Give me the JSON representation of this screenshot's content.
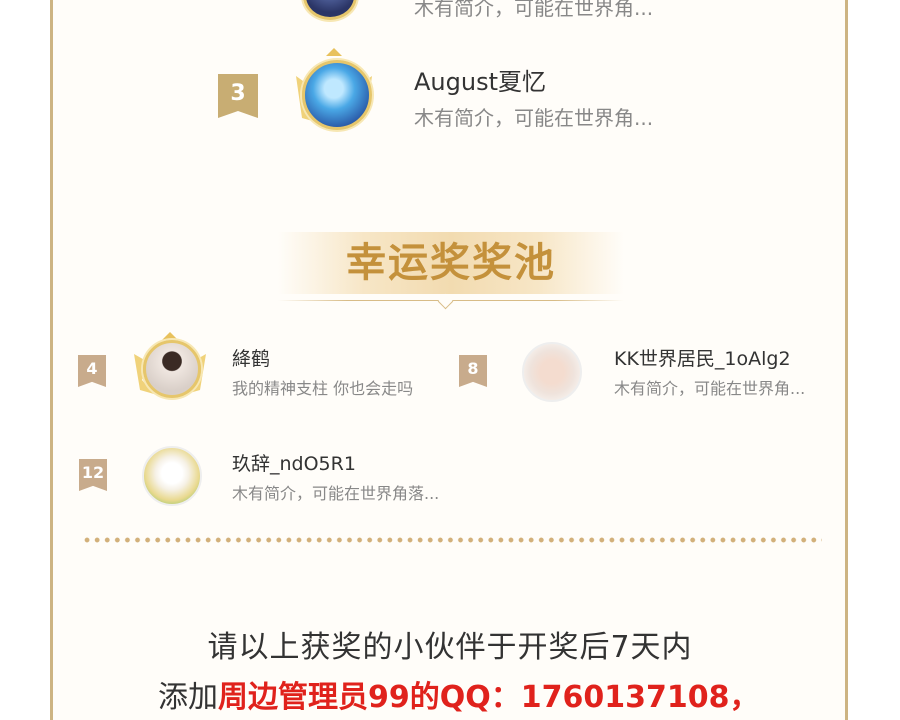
{
  "top_list": [
    {
      "rank": "",
      "name": "",
      "bio": "木有简介，可能在世界角..."
    },
    {
      "rank": "3",
      "name": "August夏忆",
      "bio": "木有简介，可能在世界角..."
    }
  ],
  "lucky_section": {
    "title": "幸运奖奖池",
    "winners": [
      {
        "rank": "4",
        "name": "絳鹤",
        "bio": "我的精神支柱 你也会走吗"
      },
      {
        "rank": "8",
        "name": "KK世界居民_1oAlg2",
        "bio": "木有简介，可能在世界角..."
      },
      {
        "rank": "12",
        "name": "玖辞_ndO5R1",
        "bio": "木有简介，可能在世界角落..."
      }
    ]
  },
  "notice": {
    "line1": "请以上获奖的小伙伴于开奖后7天内",
    "line2_prefix": "添加",
    "line2_highlight": "周边管理员99的QQ：1760137108，"
  },
  "colors": {
    "gold": "#c4913b",
    "border": "#cdb483",
    "badge": "#c8ad73",
    "red": "#e0221c"
  }
}
